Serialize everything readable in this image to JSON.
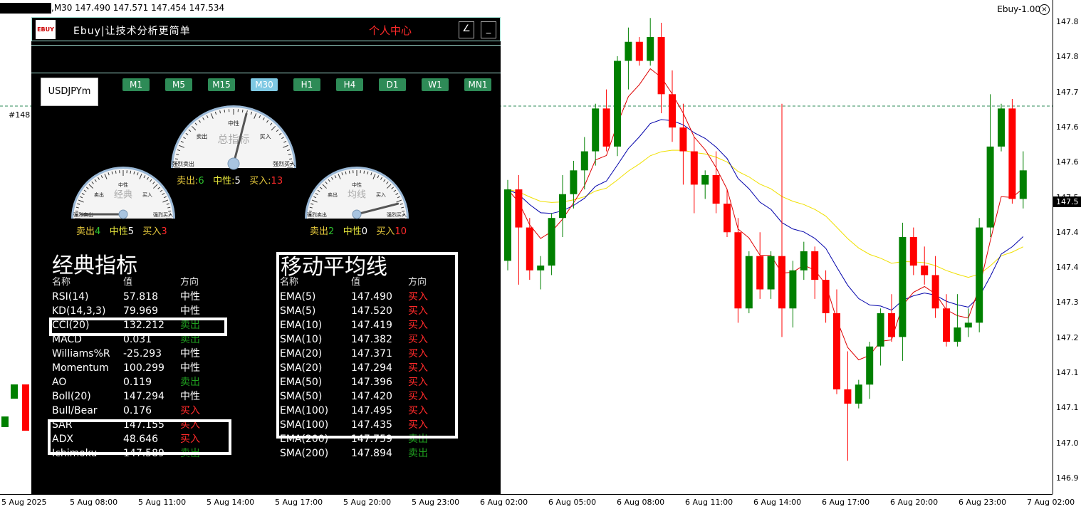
{
  "top_bar": {
    "symbol_info": ",M30  147.490 147.571 147.454 147.534",
    "indicator_name": "Ebuy-1.00",
    "close_glyph": "×",
    "object_label": "#148"
  },
  "price_axis": {
    "ticks": [
      "147.8",
      "147.8",
      "147.7",
      "147.6",
      "147.6",
      "147.5",
      "147.4",
      "147.4",
      "147.3",
      "147.2",
      "147.1",
      "147.1",
      "147.0",
      "146.9"
    ],
    "current": "147.5"
  },
  "time_axis": {
    "ticks": [
      "5 Aug 2025",
      "5 Aug 08:00",
      "5 Aug 11:00",
      "5 Aug 14:00",
      "5 Aug 17:00",
      "5 Aug 20:00",
      "5 Aug 23:00",
      "6 Aug 02:00",
      "6 Aug 05:00",
      "6 Aug 08:00",
      "6 Aug 11:00",
      "6 Aug 14:00",
      "6 Aug 17:00",
      "6 Aug 20:00",
      "6 Aug 23:00",
      "7 Aug 02:00"
    ]
  },
  "panel": {
    "logo_text": "EBUY",
    "brand": "Ebuy|让技术分析更简单",
    "personal_center": "个人中心",
    "btn_draw": "∠",
    "btn_min": "_",
    "symbol": "USDJPYm",
    "timeframes": [
      "M1",
      "M5",
      "M15",
      "M30",
      "H1",
      "H4",
      "D1",
      "W1",
      "MN1"
    ],
    "active_timeframe": "M30",
    "gauges": {
      "total": {
        "title": "总指标",
        "sell_label": "卖出:",
        "sell": "6",
        "neutral_label": "中性:",
        "neutral": "5",
        "buy_label": "买入:",
        "buy": "13",
        "needle_value": 0.58
      },
      "classic": {
        "title": "经典",
        "sell_label": "卖出",
        "sell": "4",
        "neutral_label": "中性",
        "neutral": "5",
        "buy_label": "买入",
        "buy": "3",
        "needle_value": 0.0
      },
      "ma": {
        "title": "均线",
        "sell_label": "卖出",
        "sell": "2",
        "neutral_label": "中性",
        "neutral": "0",
        "buy_label": "买入",
        "buy": "10",
        "needle_value": 0.92
      },
      "scale": {
        "strong_sell": "强烈卖出",
        "sell": "卖出",
        "neutral": "中性",
        "buy": "买入",
        "strong_buy": "强烈买入"
      }
    },
    "classic": {
      "title": "经典指标",
      "headers": [
        "名称",
        "值",
        "方向"
      ],
      "rows": [
        {
          "name": "RSI(14)",
          "value": "57.818",
          "dir": "中性",
          "type": "neutral"
        },
        {
          "name": "KD(14,3,3)",
          "value": "79.969",
          "dir": "中性",
          "type": "neutral"
        },
        {
          "name": "CCI(20)",
          "value": "132.212",
          "dir": "卖出",
          "type": "sell"
        },
        {
          "name": "MACD",
          "value": "0.031",
          "dir": "卖出",
          "type": "sell"
        },
        {
          "name": "Williams%R",
          "value": "-25.293",
          "dir": "中性",
          "type": "neutral"
        },
        {
          "name": "Momentum",
          "value": "100.299",
          "dir": "中性",
          "type": "neutral"
        },
        {
          "name": "AO",
          "value": "0.119",
          "dir": "卖出",
          "type": "sell"
        },
        {
          "name": "Boll(20)",
          "value": "147.294",
          "dir": "中性",
          "type": "neutral"
        },
        {
          "name": "Bull/Bear",
          "value": "0.176",
          "dir": "买入",
          "type": "buy"
        },
        {
          "name": "SAR",
          "value": "147.155",
          "dir": "买入",
          "type": "buy"
        },
        {
          "name": "ADX",
          "value": "48.646",
          "dir": "买入",
          "type": "buy"
        },
        {
          "name": "Ichimoku",
          "value": "147.589",
          "dir": "卖出",
          "type": "sell"
        }
      ]
    },
    "ma": {
      "title": "移动平均线",
      "headers": [
        "名称",
        "值",
        "方向"
      ],
      "rows": [
        {
          "name": "EMA(5)",
          "value": "147.490",
          "dir": "买入",
          "type": "buy"
        },
        {
          "name": "SMA(5)",
          "value": "147.520",
          "dir": "买入",
          "type": "buy"
        },
        {
          "name": "EMA(10)",
          "value": "147.419",
          "dir": "买入",
          "type": "buy"
        },
        {
          "name": "SMA(10)",
          "value": "147.382",
          "dir": "买入",
          "type": "buy"
        },
        {
          "name": "EMA(20)",
          "value": "147.371",
          "dir": "买入",
          "type": "buy"
        },
        {
          "name": "SMA(20)",
          "value": "147.294",
          "dir": "买入",
          "type": "buy"
        },
        {
          "name": "EMA(50)",
          "value": "147.396",
          "dir": "买入",
          "type": "buy"
        },
        {
          "name": "SMA(50)",
          "value": "147.420",
          "dir": "买入",
          "type": "buy"
        },
        {
          "name": "EMA(100)",
          "value": "147.495",
          "dir": "买入",
          "type": "buy"
        },
        {
          "name": "SMA(100)",
          "value": "147.435",
          "dir": "买入",
          "type": "buy"
        },
        {
          "name": "EMA(200)",
          "value": "147.759",
          "dir": "卖出",
          "type": "sell"
        },
        {
          "name": "SMA(200)",
          "value": "147.894",
          "dir": "卖出",
          "type": "sell"
        }
      ]
    }
  },
  "candles": [
    [
      147.32,
      147.49,
      147.3,
      147.47
    ],
    [
      147.47,
      147.5,
      147.27,
      147.39
    ],
    [
      147.39,
      147.41,
      147.28,
      147.3
    ],
    [
      147.3,
      147.33,
      147.26,
      147.31
    ],
    [
      147.31,
      147.42,
      147.29,
      147.41
    ],
    [
      147.41,
      147.5,
      147.37,
      147.46
    ],
    [
      147.46,
      147.53,
      147.43,
      147.51
    ],
    [
      147.51,
      147.58,
      147.47,
      147.55
    ],
    [
      147.55,
      147.65,
      147.52,
      147.64
    ],
    [
      147.64,
      147.68,
      147.55,
      147.56
    ],
    [
      147.56,
      147.75,
      147.54,
      147.74
    ],
    [
      147.74,
      147.81,
      147.68,
      147.78
    ],
    [
      147.78,
      147.79,
      147.73,
      147.74
    ],
    [
      147.74,
      147.83,
      147.73,
      147.79
    ],
    [
      147.79,
      147.82,
      147.63,
      147.67
    ],
    [
      147.67,
      147.72,
      147.57,
      147.6
    ],
    [
      147.6,
      147.65,
      147.48,
      147.55
    ],
    [
      147.55,
      147.58,
      147.42,
      147.48
    ],
    [
      147.48,
      147.51,
      147.45,
      147.5
    ],
    [
      147.5,
      147.55,
      147.42,
      147.44
    ],
    [
      147.44,
      147.47,
      147.37,
      147.38
    ],
    [
      147.38,
      147.41,
      147.19,
      147.22
    ],
    [
      147.22,
      147.34,
      147.21,
      147.33
    ],
    [
      147.33,
      147.38,
      147.24,
      147.26
    ],
    [
      147.26,
      147.34,
      147.24,
      147.33
    ],
    [
      147.33,
      147.65,
      147.16,
      147.22
    ],
    [
      147.22,
      147.32,
      147.18,
      147.3
    ],
    [
      147.3,
      147.36,
      147.28,
      147.34
    ],
    [
      147.34,
      147.35,
      147.24,
      147.28
    ],
    [
      147.28,
      147.3,
      147.19,
      147.21
    ],
    [
      147.21,
      147.26,
      147.04,
      147.05
    ],
    [
      147.05,
      147.13,
      146.9,
      147.02
    ],
    [
      147.02,
      147.07,
      147.01,
      147.06
    ],
    [
      147.06,
      147.15,
      147.03,
      147.14
    ],
    [
      147.14,
      147.22,
      147.1,
      147.21
    ],
    [
      147.21,
      147.25,
      147.15,
      147.16
    ],
    [
      147.16,
      147.4,
      147.11,
      147.37
    ],
    [
      147.37,
      147.39,
      147.29,
      147.31
    ],
    [
      147.31,
      147.35,
      147.27,
      147.29
    ],
    [
      147.29,
      147.33,
      147.2,
      147.22
    ],
    [
      147.22,
      147.25,
      147.14,
      147.15
    ],
    [
      147.15,
      147.25,
      147.14,
      147.18
    ],
    [
      147.18,
      147.22,
      147.16,
      147.19
    ],
    [
      147.19,
      147.41,
      147.17,
      147.39
    ],
    [
      147.39,
      147.67,
      147.37,
      147.56
    ],
    [
      147.56,
      147.65,
      147.55,
      147.64
    ],
    [
      147.64,
      147.66,
      147.44,
      147.45
    ],
    [
      147.45,
      147.55,
      147.43,
      147.51
    ]
  ]
}
